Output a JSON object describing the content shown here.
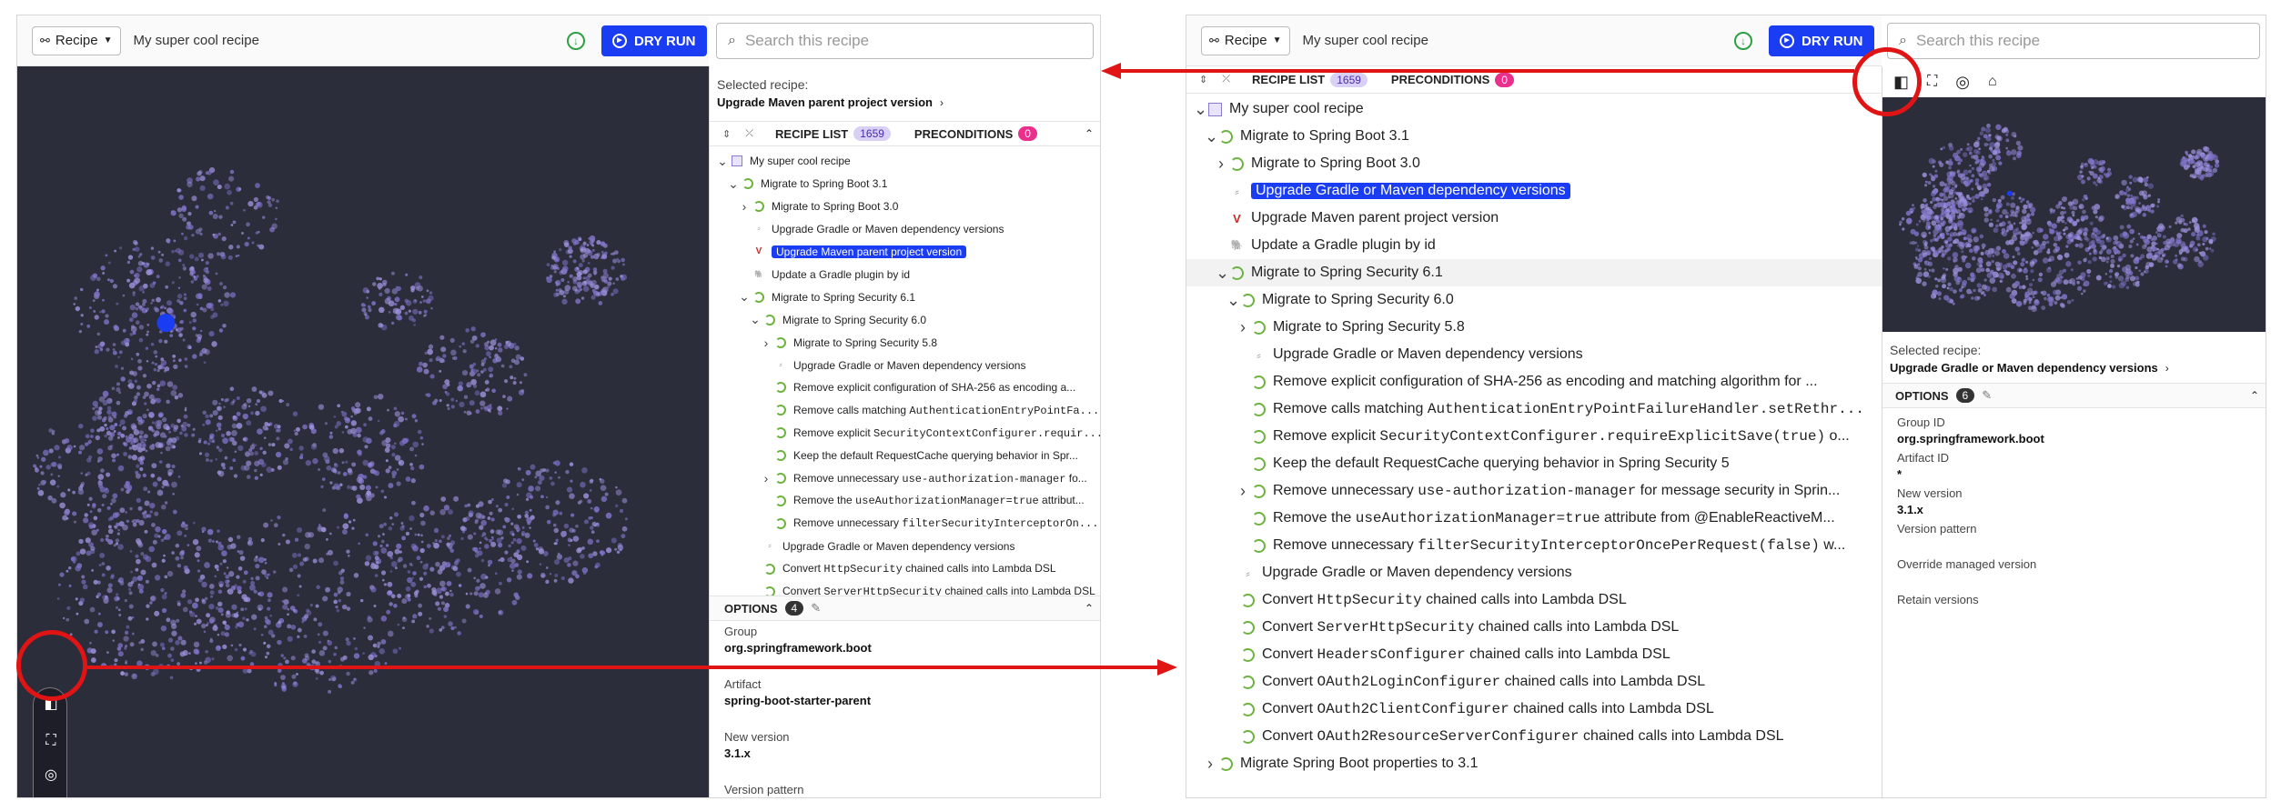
{
  "toolbar": {
    "recipe_button": "Recipe",
    "recipe_name": "My super cool recipe",
    "dry_run": "DRY RUN"
  },
  "search": {
    "placeholder": "Search this recipe"
  },
  "colors": {
    "accent": "#1a3cf2",
    "graph_bg": "#2b2d3b",
    "annotation_red": "#e01414",
    "spring_green": "#6cb33f"
  },
  "left": {
    "selected_label": "Selected recipe:",
    "selected_value": "Upgrade Maven parent project version",
    "tabs": {
      "recipe_list": "RECIPE LIST",
      "recipe_count": "1659",
      "preconditions": "PRECONDITIONS",
      "precond_count": "0"
    },
    "tree": [
      {
        "level": 0,
        "chev": "v",
        "icon": "cube",
        "text": "My super cool recipe"
      },
      {
        "level": 1,
        "chev": "v",
        "icon": "spring",
        "text": "Migrate to Spring Boot 3.1"
      },
      {
        "level": 2,
        "chev": ">",
        "icon": "spring",
        "text": "Migrate to Spring Boot 3.0"
      },
      {
        "level": 2,
        "chev": "",
        "icon": "text",
        "text": "Upgrade Gradle or Maven dependency versions"
      },
      {
        "level": 2,
        "chev": "",
        "icon": "maven",
        "text": "Upgrade Maven parent project version",
        "highlight": true
      },
      {
        "level": 2,
        "chev": "",
        "icon": "gradle",
        "text": "Update a Gradle plugin by id"
      },
      {
        "level": 2,
        "chev": "v",
        "icon": "spring",
        "text": "Migrate to Spring Security 6.1"
      },
      {
        "level": 3,
        "chev": "v",
        "icon": "spring",
        "text": "Migrate to Spring Security 6.0"
      },
      {
        "level": 4,
        "chev": ">",
        "icon": "spring",
        "text": "Migrate to Spring Security 5.8"
      },
      {
        "level": 4,
        "chev": "",
        "icon": "text",
        "text": "Upgrade Gradle or Maven dependency versions"
      },
      {
        "level": 4,
        "chev": "",
        "icon": "spring",
        "text": "Remove explicit configuration of SHA-256 as encoding a..."
      },
      {
        "level": 4,
        "chev": "",
        "icon": "spring",
        "parts": [
          {
            "t": "Remove calls matching "
          },
          {
            "t": "AuthenticationEntryPointFa...",
            "mono": true
          }
        ]
      },
      {
        "level": 4,
        "chev": "",
        "icon": "spring",
        "parts": [
          {
            "t": "Remove explicit "
          },
          {
            "t": "SecurityContextConfigurer.requir...",
            "mono": true
          }
        ]
      },
      {
        "level": 4,
        "chev": "",
        "icon": "spring",
        "text": "Keep the default RequestCache querying behavior in Spr..."
      },
      {
        "level": 4,
        "chev": ">",
        "icon": "spring",
        "parts": [
          {
            "t": "Remove unnecessary "
          },
          {
            "t": "use-authorization-manager",
            "mono": true
          },
          {
            "t": " fo..."
          }
        ]
      },
      {
        "level": 4,
        "chev": "",
        "icon": "spring",
        "parts": [
          {
            "t": "Remove the "
          },
          {
            "t": "useAuthorizationManager=true",
            "mono": true
          },
          {
            "t": " attribut..."
          }
        ]
      },
      {
        "level": 4,
        "chev": "",
        "icon": "spring",
        "parts": [
          {
            "t": "Remove unnecessary "
          },
          {
            "t": "filterSecurityInterceptorOn...",
            "mono": true
          }
        ]
      },
      {
        "level": 3,
        "chev": "",
        "icon": "text",
        "text": "Upgrade Gradle or Maven dependency versions"
      },
      {
        "level": 3,
        "chev": "",
        "icon": "spring",
        "parts": [
          {
            "t": "Convert "
          },
          {
            "t": "HttpSecurity",
            "mono": true
          },
          {
            "t": " chained calls into Lambda DSL"
          }
        ]
      },
      {
        "level": 3,
        "chev": "",
        "icon": "spring",
        "parts": [
          {
            "t": "Convert "
          },
          {
            "t": "ServerHttpSecurity",
            "mono": true
          },
          {
            "t": " chained calls into Lambda DSL"
          }
        ]
      }
    ],
    "options_title": "OPTIONS",
    "options_count": "4",
    "options": [
      {
        "label": "Group",
        "value": "org.springframework.boot"
      },
      {
        "label": "Artifact",
        "value": "spring-boot-starter-parent"
      },
      {
        "label": "New version",
        "value": "3.1.x"
      },
      {
        "label": "Version pattern",
        "value": ""
      }
    ]
  },
  "right": {
    "tabs": {
      "recipe_list": "RECIPE LIST",
      "recipe_count": "1659",
      "preconditions": "PRECONDITIONS",
      "precond_count": "0"
    },
    "tree": [
      {
        "level": 0,
        "chev": "v",
        "icon": "cube",
        "text": "My super cool recipe"
      },
      {
        "level": 1,
        "chev": "v",
        "icon": "spring",
        "text": "Migrate to Spring Boot 3.1"
      },
      {
        "level": 2,
        "chev": ">",
        "icon": "spring",
        "text": "Migrate to Spring Boot 3.0"
      },
      {
        "level": 2,
        "chev": "",
        "icon": "text",
        "text": "Upgrade Gradle or Maven dependency versions",
        "highlight": true
      },
      {
        "level": 2,
        "chev": "",
        "icon": "maven",
        "text": "Upgrade Maven parent project version"
      },
      {
        "level": 2,
        "chev": "",
        "icon": "gradle",
        "text": "Update a Gradle plugin by id"
      },
      {
        "level": 2,
        "chev": "v",
        "icon": "spring",
        "text": "Migrate to Spring Security 6.1",
        "rowhl": true
      },
      {
        "level": 3,
        "chev": "v",
        "icon": "spring",
        "text": "Migrate to Spring Security 6.0"
      },
      {
        "level": 4,
        "chev": ">",
        "icon": "spring",
        "text": "Migrate to Spring Security 5.8"
      },
      {
        "level": 4,
        "chev": "",
        "icon": "text",
        "text": "Upgrade Gradle or Maven dependency versions"
      },
      {
        "level": 4,
        "chev": "",
        "icon": "spring",
        "text": "Remove explicit configuration of SHA-256 as encoding and matching algorithm for ..."
      },
      {
        "level": 4,
        "chev": "",
        "icon": "spring",
        "parts": [
          {
            "t": "Remove calls matching "
          },
          {
            "t": "AuthenticationEntryPointFailureHandler.setRethr...",
            "mono": true
          }
        ]
      },
      {
        "level": 4,
        "chev": "",
        "icon": "spring",
        "parts": [
          {
            "t": "Remove explicit "
          },
          {
            "t": "SecurityContextConfigurer.requireExplicitSave(true)",
            "mono": true
          },
          {
            "t": " o..."
          }
        ]
      },
      {
        "level": 4,
        "chev": "",
        "icon": "spring",
        "text": "Keep the default RequestCache querying behavior in Spring Security 5"
      },
      {
        "level": 4,
        "chev": ">",
        "icon": "spring",
        "parts": [
          {
            "t": "Remove unnecessary "
          },
          {
            "t": "use-authorization-manager",
            "mono": true
          },
          {
            "t": " for message security in Sprin..."
          }
        ]
      },
      {
        "level": 4,
        "chev": "",
        "icon": "spring",
        "parts": [
          {
            "t": "Remove the "
          },
          {
            "t": "useAuthorizationManager=true",
            "mono": true
          },
          {
            "t": " attribute from @EnableReactiveM..."
          }
        ]
      },
      {
        "level": 4,
        "chev": "",
        "icon": "spring",
        "parts": [
          {
            "t": "Remove unnecessary "
          },
          {
            "t": "filterSecurityInterceptorOncePerRequest(false)",
            "mono": true
          },
          {
            "t": " w..."
          }
        ]
      },
      {
        "level": 3,
        "chev": "",
        "icon": "text",
        "text": "Upgrade Gradle or Maven dependency versions"
      },
      {
        "level": 3,
        "chev": "",
        "icon": "spring",
        "parts": [
          {
            "t": "Convert "
          },
          {
            "t": "HttpSecurity",
            "mono": true
          },
          {
            "t": " chained calls into Lambda DSL"
          }
        ]
      },
      {
        "level": 3,
        "chev": "",
        "icon": "spring",
        "parts": [
          {
            "t": "Convert "
          },
          {
            "t": "ServerHttpSecurity",
            "mono": true
          },
          {
            "t": " chained calls into Lambda DSL"
          }
        ]
      },
      {
        "level": 3,
        "chev": "",
        "icon": "spring",
        "parts": [
          {
            "t": "Convert "
          },
          {
            "t": "HeadersConfigurer",
            "mono": true
          },
          {
            "t": " chained calls into Lambda DSL"
          }
        ]
      },
      {
        "level": 3,
        "chev": "",
        "icon": "spring",
        "parts": [
          {
            "t": "Convert "
          },
          {
            "t": "OAuth2LoginConfigurer",
            "mono": true
          },
          {
            "t": " chained calls into Lambda DSL"
          }
        ]
      },
      {
        "level": 3,
        "chev": "",
        "icon": "spring",
        "parts": [
          {
            "t": "Convert "
          },
          {
            "t": "OAuth2ClientConfigurer",
            "mono": true
          },
          {
            "t": " chained calls into Lambda DSL"
          }
        ]
      },
      {
        "level": 3,
        "chev": "",
        "icon": "spring",
        "parts": [
          {
            "t": "Convert "
          },
          {
            "t": "OAuth2ResourceServerConfigurer",
            "mono": true
          },
          {
            "t": " chained calls into Lambda DSL"
          }
        ]
      },
      {
        "level": 1,
        "chev": ">",
        "icon": "spring",
        "text": "Migrate Spring Boot properties to 3.1"
      }
    ],
    "selected_label": "Selected recipe:",
    "selected_value": "Upgrade Gradle or Maven dependency versions",
    "options_title": "OPTIONS",
    "options_count": "6",
    "options": [
      {
        "label": "Group ID",
        "value": "org.springframework.boot"
      },
      {
        "label": "Artifact ID",
        "value": "*"
      },
      {
        "label": "New version",
        "value": "3.1.x"
      },
      {
        "label": "Version pattern",
        "value": ""
      },
      {
        "label": "Override managed version",
        "value": ""
      },
      {
        "label": "Retain versions",
        "value": ""
      }
    ]
  }
}
